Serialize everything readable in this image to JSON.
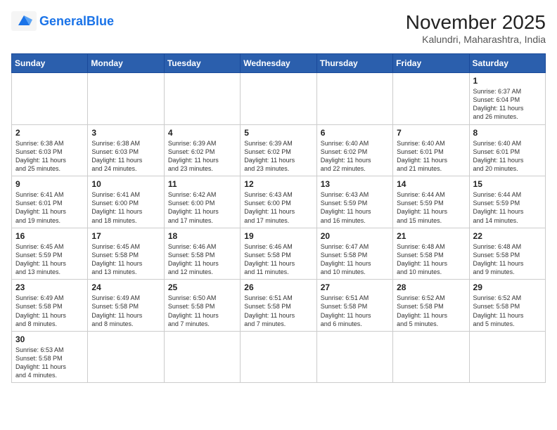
{
  "header": {
    "logo_general": "General",
    "logo_blue": "Blue",
    "title": "November 2025",
    "location": "Kalundri, Maharashtra, India"
  },
  "weekdays": [
    "Sunday",
    "Monday",
    "Tuesday",
    "Wednesday",
    "Thursday",
    "Friday",
    "Saturday"
  ],
  "weeks": [
    [
      {
        "day": "",
        "info": ""
      },
      {
        "day": "",
        "info": ""
      },
      {
        "day": "",
        "info": ""
      },
      {
        "day": "",
        "info": ""
      },
      {
        "day": "",
        "info": ""
      },
      {
        "day": "",
        "info": ""
      },
      {
        "day": "1",
        "info": "Sunrise: 6:37 AM\nSunset: 6:04 PM\nDaylight: 11 hours\nand 26 minutes."
      }
    ],
    [
      {
        "day": "2",
        "info": "Sunrise: 6:38 AM\nSunset: 6:03 PM\nDaylight: 11 hours\nand 25 minutes."
      },
      {
        "day": "3",
        "info": "Sunrise: 6:38 AM\nSunset: 6:03 PM\nDaylight: 11 hours\nand 24 minutes."
      },
      {
        "day": "4",
        "info": "Sunrise: 6:39 AM\nSunset: 6:02 PM\nDaylight: 11 hours\nand 23 minutes."
      },
      {
        "day": "5",
        "info": "Sunrise: 6:39 AM\nSunset: 6:02 PM\nDaylight: 11 hours\nand 23 minutes."
      },
      {
        "day": "6",
        "info": "Sunrise: 6:40 AM\nSunset: 6:02 PM\nDaylight: 11 hours\nand 22 minutes."
      },
      {
        "day": "7",
        "info": "Sunrise: 6:40 AM\nSunset: 6:01 PM\nDaylight: 11 hours\nand 21 minutes."
      },
      {
        "day": "8",
        "info": "Sunrise: 6:40 AM\nSunset: 6:01 PM\nDaylight: 11 hours\nand 20 minutes."
      }
    ],
    [
      {
        "day": "9",
        "info": "Sunrise: 6:41 AM\nSunset: 6:01 PM\nDaylight: 11 hours\nand 19 minutes."
      },
      {
        "day": "10",
        "info": "Sunrise: 6:41 AM\nSunset: 6:00 PM\nDaylight: 11 hours\nand 18 minutes."
      },
      {
        "day": "11",
        "info": "Sunrise: 6:42 AM\nSunset: 6:00 PM\nDaylight: 11 hours\nand 17 minutes."
      },
      {
        "day": "12",
        "info": "Sunrise: 6:43 AM\nSunset: 6:00 PM\nDaylight: 11 hours\nand 17 minutes."
      },
      {
        "day": "13",
        "info": "Sunrise: 6:43 AM\nSunset: 5:59 PM\nDaylight: 11 hours\nand 16 minutes."
      },
      {
        "day": "14",
        "info": "Sunrise: 6:44 AM\nSunset: 5:59 PM\nDaylight: 11 hours\nand 15 minutes."
      },
      {
        "day": "15",
        "info": "Sunrise: 6:44 AM\nSunset: 5:59 PM\nDaylight: 11 hours\nand 14 minutes."
      }
    ],
    [
      {
        "day": "16",
        "info": "Sunrise: 6:45 AM\nSunset: 5:59 PM\nDaylight: 11 hours\nand 13 minutes."
      },
      {
        "day": "17",
        "info": "Sunrise: 6:45 AM\nSunset: 5:58 PM\nDaylight: 11 hours\nand 13 minutes."
      },
      {
        "day": "18",
        "info": "Sunrise: 6:46 AM\nSunset: 5:58 PM\nDaylight: 11 hours\nand 12 minutes."
      },
      {
        "day": "19",
        "info": "Sunrise: 6:46 AM\nSunset: 5:58 PM\nDaylight: 11 hours\nand 11 minutes."
      },
      {
        "day": "20",
        "info": "Sunrise: 6:47 AM\nSunset: 5:58 PM\nDaylight: 11 hours\nand 10 minutes."
      },
      {
        "day": "21",
        "info": "Sunrise: 6:48 AM\nSunset: 5:58 PM\nDaylight: 11 hours\nand 10 minutes."
      },
      {
        "day": "22",
        "info": "Sunrise: 6:48 AM\nSunset: 5:58 PM\nDaylight: 11 hours\nand 9 minutes."
      }
    ],
    [
      {
        "day": "23",
        "info": "Sunrise: 6:49 AM\nSunset: 5:58 PM\nDaylight: 11 hours\nand 8 minutes."
      },
      {
        "day": "24",
        "info": "Sunrise: 6:49 AM\nSunset: 5:58 PM\nDaylight: 11 hours\nand 8 minutes."
      },
      {
        "day": "25",
        "info": "Sunrise: 6:50 AM\nSunset: 5:58 PM\nDaylight: 11 hours\nand 7 minutes."
      },
      {
        "day": "26",
        "info": "Sunrise: 6:51 AM\nSunset: 5:58 PM\nDaylight: 11 hours\nand 7 minutes."
      },
      {
        "day": "27",
        "info": "Sunrise: 6:51 AM\nSunset: 5:58 PM\nDaylight: 11 hours\nand 6 minutes."
      },
      {
        "day": "28",
        "info": "Sunrise: 6:52 AM\nSunset: 5:58 PM\nDaylight: 11 hours\nand 5 minutes."
      },
      {
        "day": "29",
        "info": "Sunrise: 6:52 AM\nSunset: 5:58 PM\nDaylight: 11 hours\nand 5 minutes."
      }
    ],
    [
      {
        "day": "30",
        "info": "Sunrise: 6:53 AM\nSunset: 5:58 PM\nDaylight: 11 hours\nand 4 minutes."
      },
      {
        "day": "",
        "info": ""
      },
      {
        "day": "",
        "info": ""
      },
      {
        "day": "",
        "info": ""
      },
      {
        "day": "",
        "info": ""
      },
      {
        "day": "",
        "info": ""
      },
      {
        "day": "",
        "info": ""
      }
    ]
  ]
}
